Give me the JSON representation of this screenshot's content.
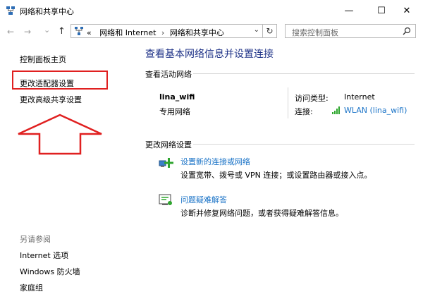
{
  "window": {
    "title": "网络和共享中心",
    "controls": {
      "minimize": "—",
      "maximize": "☐",
      "close": "✕"
    }
  },
  "nav": {
    "back": "←",
    "forward": "→",
    "dropdown": "⌄",
    "up": "↑",
    "breadcrumb": [
      "«",
      "网络和 Internet",
      "网络和共享中心"
    ],
    "refresh": "↻",
    "search_placeholder": "搜索控制面板"
  },
  "sidebar": {
    "home": "控制面板主页",
    "adapter_settings": "更改适配器设置",
    "advanced_sharing": "更改高级共享设置",
    "see_also_title": "另请参阅",
    "see_also": [
      "Internet 选项",
      "Windows 防火墙",
      "家庭组"
    ]
  },
  "main": {
    "title": "查看基本网络信息并设置连接",
    "active_networks_header": "查看活动网络",
    "network": {
      "name": "lina_wifi",
      "type": "专用网络",
      "access_type_label": "访问类型:",
      "access_type_value": "Internet",
      "connections_label": "连接:",
      "connection_value": "WLAN (lina_wifi)"
    },
    "change_settings_header": "更改网络设置",
    "tasks": [
      {
        "link": "设置新的连接或网络",
        "desc": "设置宽带、拨号或 VPN 连接；或设置路由器或接入点。"
      },
      {
        "link": "问题疑难解答",
        "desc": "诊断并修复网络问题，或者获得疑难解答信息。"
      }
    ]
  },
  "colors": {
    "accent_red": "#e02020",
    "link_blue": "#1a73c7",
    "title_blue": "#1e3287"
  }
}
